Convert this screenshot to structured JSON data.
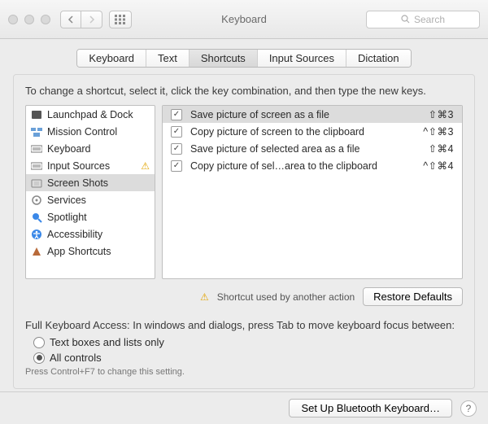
{
  "window": {
    "title": "Keyboard",
    "search_placeholder": "Search"
  },
  "tabs": [
    {
      "label": "Keyboard",
      "active": false
    },
    {
      "label": "Text",
      "active": false
    },
    {
      "label": "Shortcuts",
      "active": true
    },
    {
      "label": "Input Sources",
      "active": false
    },
    {
      "label": "Dictation",
      "active": false
    }
  ],
  "instruction": "To change a shortcut, select it, click the key combination, and then type the new keys.",
  "categories": [
    {
      "label": "Launchpad & Dock",
      "icon": "launchpad",
      "selected": false,
      "warning": false
    },
    {
      "label": "Mission Control",
      "icon": "mission-control",
      "selected": false,
      "warning": false
    },
    {
      "label": "Keyboard",
      "icon": "keyboard",
      "selected": false,
      "warning": false
    },
    {
      "label": "Input Sources",
      "icon": "keyboard",
      "selected": false,
      "warning": true
    },
    {
      "label": "Screen Shots",
      "icon": "screenshot",
      "selected": true,
      "warning": false
    },
    {
      "label": "Services",
      "icon": "services",
      "selected": false,
      "warning": false
    },
    {
      "label": "Spotlight",
      "icon": "spotlight",
      "selected": false,
      "warning": false
    },
    {
      "label": "Accessibility",
      "icon": "accessibility",
      "selected": false,
      "warning": false
    },
    {
      "label": "App Shortcuts",
      "icon": "app-shortcuts",
      "selected": false,
      "warning": false
    }
  ],
  "shortcuts": [
    {
      "enabled": true,
      "label": "Save picture of screen as a file",
      "keys": "⇧⌘3",
      "selected": true
    },
    {
      "enabled": true,
      "label": "Copy picture of screen to the clipboard",
      "keys": "^⇧⌘3",
      "selected": false
    },
    {
      "enabled": true,
      "label": "Save picture of selected area as a file",
      "keys": "⇧⌘4",
      "selected": false
    },
    {
      "enabled": true,
      "label": "Copy picture of sel…area to the clipboard",
      "keys": "^⇧⌘4",
      "selected": false
    }
  ],
  "conflict_notice": "Shortcut used by another action",
  "restore_label": "Restore Defaults",
  "fka": {
    "label": "Full Keyboard Access: In windows and dialogs, press Tab to move keyboard focus between:",
    "options": [
      {
        "label": "Text boxes and lists only",
        "selected": false
      },
      {
        "label": "All controls",
        "selected": true
      }
    ],
    "hint": "Press Control+F7 to change this setting."
  },
  "bottom": {
    "bluetooth_label": "Set Up Bluetooth Keyboard…"
  }
}
